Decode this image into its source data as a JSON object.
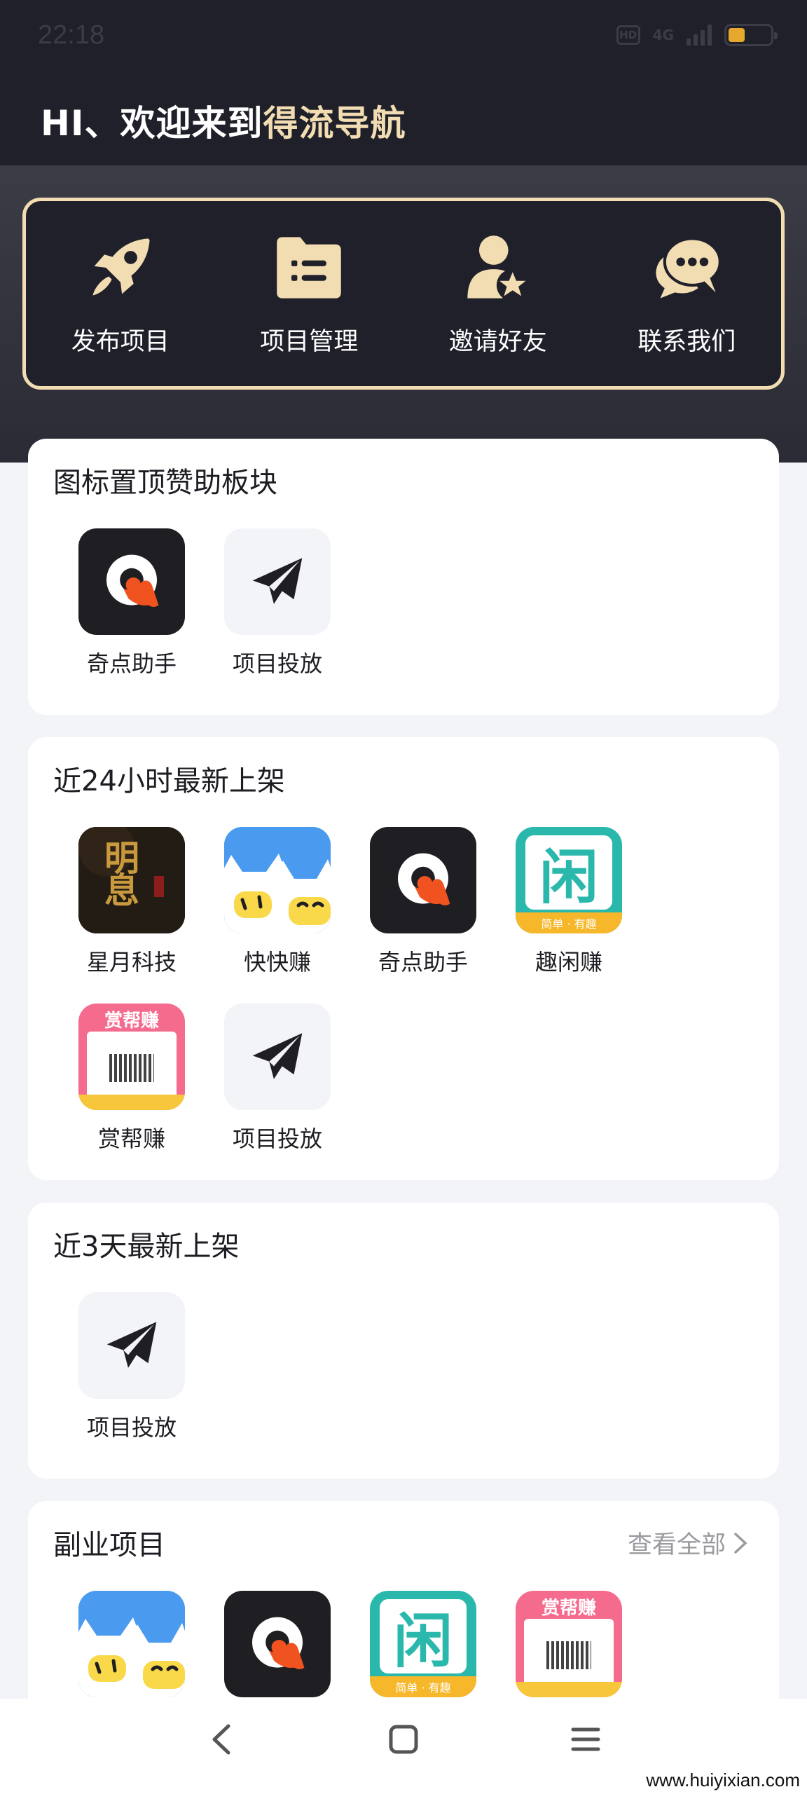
{
  "status_bar": {
    "time": "22:18",
    "hd_label": "HD",
    "network": "4G",
    "battery_percent": 40,
    "battery_color": "#e6a92e"
  },
  "header": {
    "greeting_prefix": "HI、欢迎来到",
    "greeting_brand": "得流导航",
    "accent_color": "#f2dcb2",
    "background": "#1f202a"
  },
  "quick_menu": [
    {
      "label": "发布项目",
      "icon": "rocket-icon"
    },
    {
      "label": "项目管理",
      "icon": "folder-list-icon"
    },
    {
      "label": "邀请好友",
      "icon": "user-star-icon"
    },
    {
      "label": "联系我们",
      "icon": "chat-bubbles-icon"
    }
  ],
  "sections": {
    "sponsor": {
      "title": "图标置顶赞助板块",
      "apps": [
        {
          "label": "奇点助手",
          "icon": "qidian-logo"
        },
        {
          "label": "项目投放",
          "icon": "paper-plane-icon"
        }
      ]
    },
    "new_24h": {
      "title": "近24小时最新上架",
      "apps": [
        {
          "label": "星月科技",
          "icon": "xingyue-logo",
          "logo_text": "明息"
        },
        {
          "label": "快快赚",
          "icon": "kuaikuai-logo"
        },
        {
          "label": "奇点助手",
          "icon": "qidian-logo"
        },
        {
          "label": "趣闲赚",
          "icon": "quxian-logo",
          "logo_text": "闲",
          "logo_sub": "简单 · 有趣"
        },
        {
          "label": "赏帮赚",
          "icon": "shangbang-logo",
          "logo_text": "赏帮赚"
        },
        {
          "label": "项目投放",
          "icon": "paper-plane-icon"
        }
      ]
    },
    "new_3d": {
      "title": "近3天最新上架",
      "apps": [
        {
          "label": "项目投放",
          "icon": "paper-plane-icon"
        }
      ]
    },
    "side": {
      "title": "副业项目",
      "more_label": "查看全部",
      "apps": [
        {
          "icon": "kuaikuai-logo"
        },
        {
          "icon": "qidian-logo"
        },
        {
          "icon": "quxian-logo",
          "logo_text": "闲",
          "logo_sub": "简单 · 有趣"
        },
        {
          "icon": "shangbang-logo",
          "logo_text": "赏帮赚"
        },
        {
          "icon": "paper-plane-icon"
        }
      ]
    }
  },
  "nav": [
    {
      "icon": "back-icon"
    },
    {
      "icon": "home-square-icon"
    },
    {
      "icon": "menu-icon"
    }
  ],
  "watermark": "www.huiyixian.com"
}
